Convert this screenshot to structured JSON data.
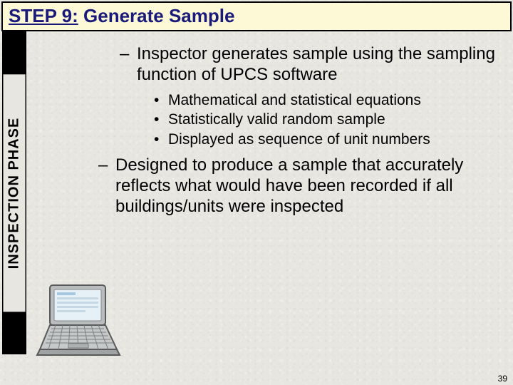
{
  "title": {
    "step_label": "STEP 9:",
    "rest": " Generate Sample"
  },
  "side_label": "INSPECTION PHASE",
  "dash1": "Inspector generates sample using the sampling function of UPCS software",
  "bullets": {
    "b1": "Mathematical and statistical equations",
    "b2": "Statistically valid random sample",
    "b3": "Displayed as sequence of unit numbers"
  },
  "dash2": "Designed to produce a sample that accurately reflects what would have been recorded if all buildings/units were inspected",
  "page_number": "39"
}
